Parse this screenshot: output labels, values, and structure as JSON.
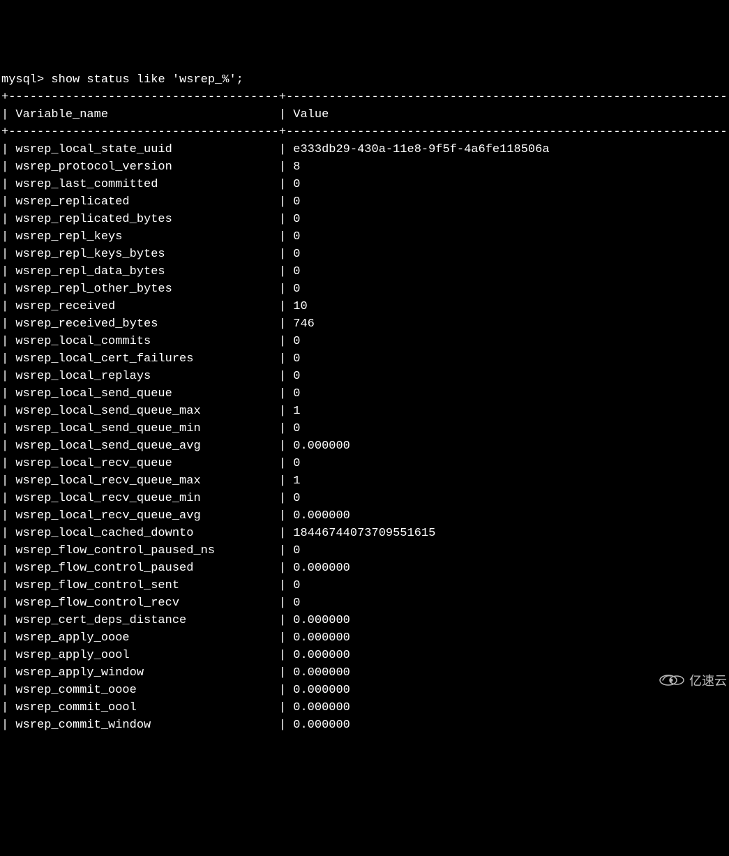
{
  "prompt": "mysql> ",
  "command": "show status like 'wsrep_%';",
  "header": {
    "col1": "Variable_name",
    "col2": "Value"
  },
  "rows": [
    {
      "name": "wsrep_local_state_uuid",
      "value": "e333db29-430a-11e8-9f5f-4a6fe118506a"
    },
    {
      "name": "wsrep_protocol_version",
      "value": "8"
    },
    {
      "name": "wsrep_last_committed",
      "value": "0"
    },
    {
      "name": "wsrep_replicated",
      "value": "0"
    },
    {
      "name": "wsrep_replicated_bytes",
      "value": "0"
    },
    {
      "name": "wsrep_repl_keys",
      "value": "0"
    },
    {
      "name": "wsrep_repl_keys_bytes",
      "value": "0"
    },
    {
      "name": "wsrep_repl_data_bytes",
      "value": "0"
    },
    {
      "name": "wsrep_repl_other_bytes",
      "value": "0"
    },
    {
      "name": "wsrep_received",
      "value": "10"
    },
    {
      "name": "wsrep_received_bytes",
      "value": "746"
    },
    {
      "name": "wsrep_local_commits",
      "value": "0"
    },
    {
      "name": "wsrep_local_cert_failures",
      "value": "0"
    },
    {
      "name": "wsrep_local_replays",
      "value": "0"
    },
    {
      "name": "wsrep_local_send_queue",
      "value": "0"
    },
    {
      "name": "wsrep_local_send_queue_max",
      "value": "1"
    },
    {
      "name": "wsrep_local_send_queue_min",
      "value": "0"
    },
    {
      "name": "wsrep_local_send_queue_avg",
      "value": "0.000000"
    },
    {
      "name": "wsrep_local_recv_queue",
      "value": "0"
    },
    {
      "name": "wsrep_local_recv_queue_max",
      "value": "1"
    },
    {
      "name": "wsrep_local_recv_queue_min",
      "value": "0"
    },
    {
      "name": "wsrep_local_recv_queue_avg",
      "value": "0.000000"
    },
    {
      "name": "wsrep_local_cached_downto",
      "value": "18446744073709551615"
    },
    {
      "name": "wsrep_flow_control_paused_ns",
      "value": "0"
    },
    {
      "name": "wsrep_flow_control_paused",
      "value": "0.000000"
    },
    {
      "name": "wsrep_flow_control_sent",
      "value": "0"
    },
    {
      "name": "wsrep_flow_control_recv",
      "value": "0"
    },
    {
      "name": "wsrep_cert_deps_distance",
      "value": "0.000000"
    },
    {
      "name": "wsrep_apply_oooe",
      "value": "0.000000"
    },
    {
      "name": "wsrep_apply_oool",
      "value": "0.000000"
    },
    {
      "name": "wsrep_apply_window",
      "value": "0.000000"
    },
    {
      "name": "wsrep_commit_oooe",
      "value": "0.000000"
    },
    {
      "name": "wsrep_commit_oool",
      "value": "0.000000"
    },
    {
      "name": "wsrep_commit_window",
      "value": "0.000000"
    }
  ],
  "watermark": "亿速云",
  "layout": {
    "col1_width": 36,
    "col2_width": 62
  }
}
